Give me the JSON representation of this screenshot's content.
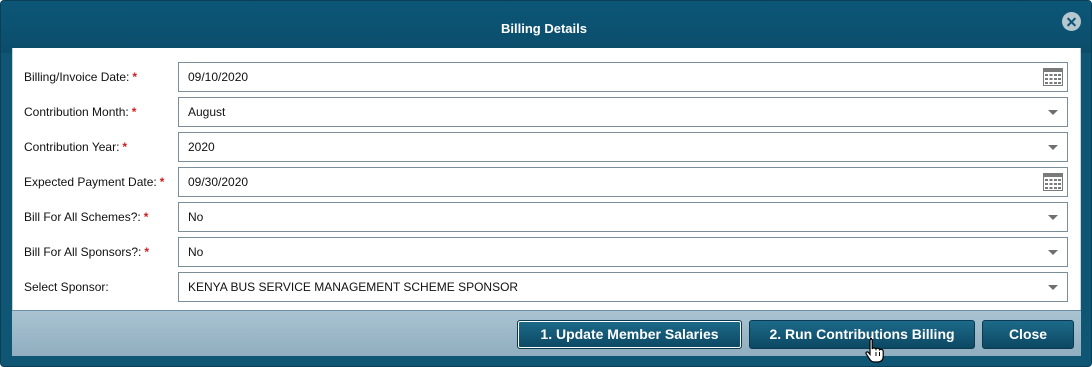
{
  "dialog": {
    "title": "Billing Details",
    "close_icon": "close-circle-icon"
  },
  "form": {
    "required_marker": "*",
    "fields": [
      {
        "label": "Billing/Invoice Date:",
        "required": true,
        "value": "09/10/2020",
        "control": "date",
        "icon": "calendar-icon"
      },
      {
        "label": "Contribution Month:",
        "required": true,
        "value": "August",
        "control": "select",
        "icon": "chevron-down-icon"
      },
      {
        "label": "Contribution Year:",
        "required": true,
        "value": "2020",
        "control": "select",
        "icon": "chevron-down-icon"
      },
      {
        "label": "Expected Payment Date:",
        "required": true,
        "value": "09/30/2020",
        "control": "date",
        "icon": "calendar-icon"
      },
      {
        "label": "Bill For All Schemes?:",
        "required": true,
        "value": "No",
        "control": "select",
        "icon": "chevron-down-icon"
      },
      {
        "label": "Bill For All Sponsors?:",
        "required": true,
        "value": "No",
        "control": "select",
        "icon": "chevron-down-icon"
      },
      {
        "label": "Select Sponsor:",
        "required": false,
        "value": "KENYA BUS SERVICE MANAGEMENT SCHEME SPONSOR",
        "control": "select",
        "icon": "chevron-down-icon"
      }
    ]
  },
  "buttons": {
    "update_salaries": "1. Update Member Salaries",
    "run_billing": "2. Run Contributions Billing",
    "close": "Close"
  },
  "colors": {
    "header": "#0f5674",
    "button": "#15597a",
    "footer": "#a3bfce",
    "required": "#cc1f1f"
  }
}
